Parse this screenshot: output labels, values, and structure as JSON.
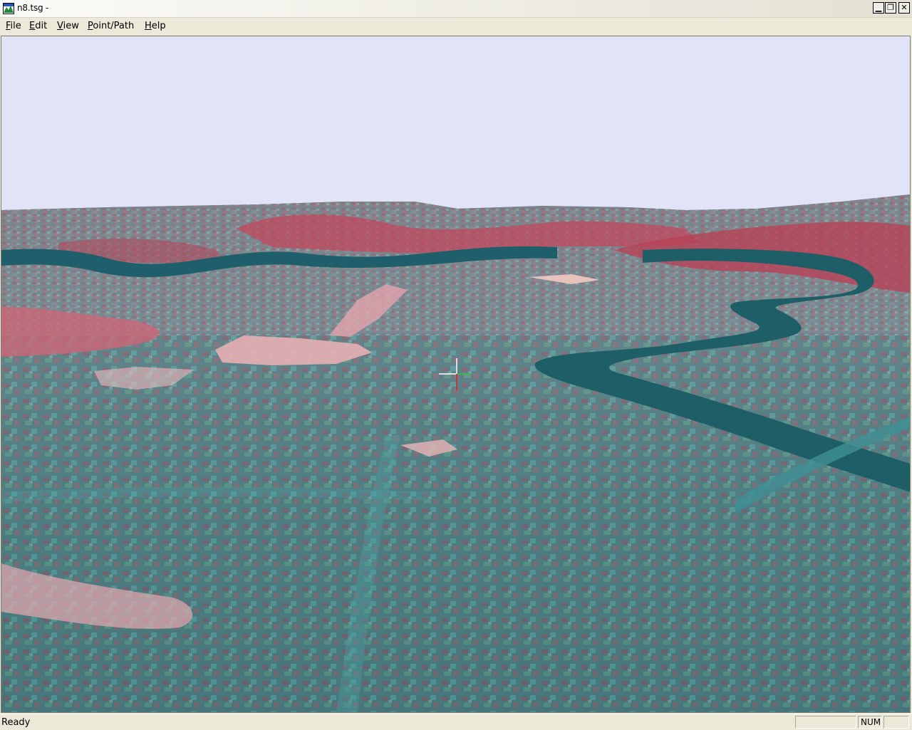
{
  "window": {
    "title": "n8.tsg -",
    "icon": "terrain-app-icon",
    "buttons": {
      "minimize": "minimize-icon",
      "restore": "restore-icon",
      "close": "close-icon"
    }
  },
  "menu": {
    "items": [
      {
        "label": "File",
        "accel": "F"
      },
      {
        "label": "Edit",
        "accel": "E"
      },
      {
        "label": "View",
        "accel": "V"
      },
      {
        "label": "Point/Path",
        "accel": "P"
      },
      {
        "label": "Help",
        "accel": "H"
      }
    ]
  },
  "viewport": {
    "content": "3d-terrain-view",
    "sky_color": "#e0e4f6",
    "crosshair_icon": "crosshair-icon"
  },
  "status": {
    "text": "Ready",
    "panes": [
      "",
      "NUM",
      ""
    ]
  }
}
